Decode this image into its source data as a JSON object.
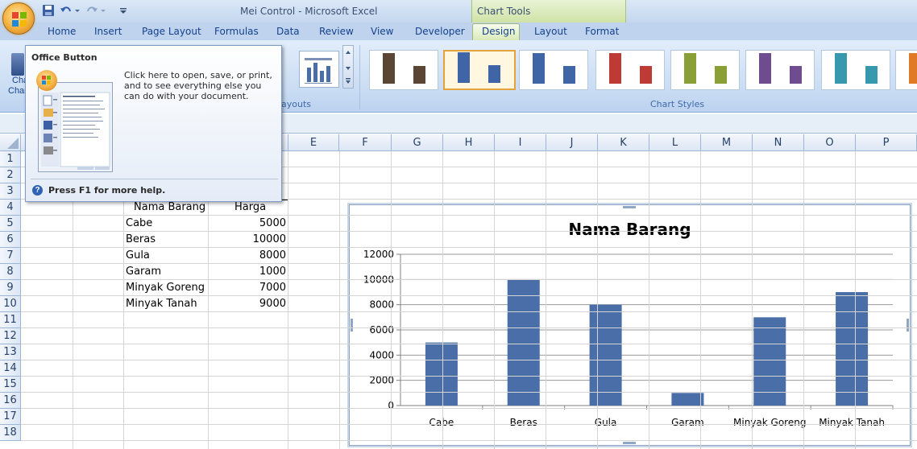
{
  "window": {
    "title": "Mei Control - Microsoft Excel",
    "context_band": "Chart Tools"
  },
  "tabs": [
    {
      "label": "Home"
    },
    {
      "label": "Insert"
    },
    {
      "label": "Page Layout"
    },
    {
      "label": "Formulas"
    },
    {
      "label": "Data"
    },
    {
      "label": "Review"
    },
    {
      "label": "View"
    },
    {
      "label": "Developer"
    },
    {
      "label": "Design"
    },
    {
      "label": "Layout"
    },
    {
      "label": "Format"
    }
  ],
  "ribbon": {
    "change_chart_partial_1": "Cha",
    "change_chart_partial_2": "Char",
    "layouts_partial": "ayouts",
    "chart_styles_label": "Chart Styles",
    "style_colors": [
      "#5b4535",
      "#3f65a6",
      "#3f65a6",
      "#bd3a35",
      "#8aa036",
      "#6f4b8f",
      "#3799ad",
      "#e07a26"
    ]
  },
  "tooltip": {
    "title": "Office Button",
    "body": "Click here to open, save, or print, and to see everything else you can do with your document.",
    "help": "Press F1 for more help."
  },
  "columns": [
    "E",
    "F",
    "G",
    "H",
    "I",
    "J",
    "K",
    "L",
    "M",
    "N",
    "O",
    "P"
  ],
  "rows": [
    "1",
    "2",
    "3",
    "4",
    "5",
    "6",
    "7",
    "8",
    "9",
    "10",
    "11",
    "12",
    "13",
    "14",
    "15",
    "16",
    "17",
    "18"
  ],
  "table": {
    "header_item": "Nama Barang",
    "header_price": "Harga",
    "rows": [
      {
        "item": "Cabe",
        "price": "5000"
      },
      {
        "item": "Beras",
        "price": "10000"
      },
      {
        "item": "Gula",
        "price": "8000"
      },
      {
        "item": "Garam",
        "price": "1000"
      },
      {
        "item": "Minyak Goreng",
        "price": "7000"
      },
      {
        "item": "Minyak Tanah",
        "price": "9000"
      }
    ]
  },
  "chart_data": {
    "type": "bar",
    "title": "Nama Barang",
    "categories": [
      "Cabe",
      "Beras",
      "Gula",
      "Garam",
      "Minyak Goreng",
      "Minyak Tanah"
    ],
    "values": [
      5000,
      10000,
      8000,
      1000,
      7000,
      9000
    ],
    "yticks": [
      "0",
      "2000",
      "4000",
      "6000",
      "8000",
      "10000",
      "12000"
    ],
    "ylim": [
      0,
      12000
    ],
    "grid": true,
    "legend": "none",
    "bar_color": "#4a6ea8"
  }
}
